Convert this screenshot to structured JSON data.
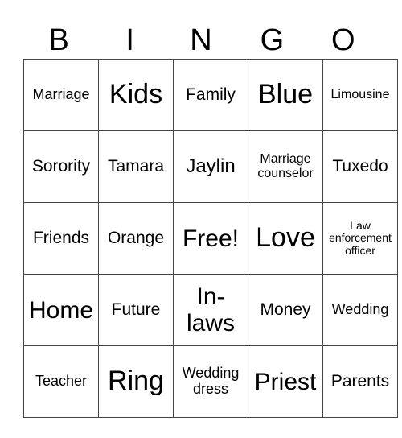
{
  "header": [
    "B",
    "I",
    "N",
    "G",
    "O"
  ],
  "rows": [
    [
      "Marriage",
      "Kids",
      "Family",
      "Blue",
      "Limousine"
    ],
    [
      "Sorority",
      "Tamara",
      "Jaylin",
      "Marriage counselor",
      "Tuxedo"
    ],
    [
      "Friends",
      "Orange",
      "Free!",
      "Love",
      "Law enforcement officer"
    ],
    [
      "Home",
      "Future",
      "In-laws",
      "Money",
      "Wedding"
    ],
    [
      "Teacher",
      "Ring",
      "Wedding dress",
      "Priest",
      "Parents"
    ]
  ]
}
